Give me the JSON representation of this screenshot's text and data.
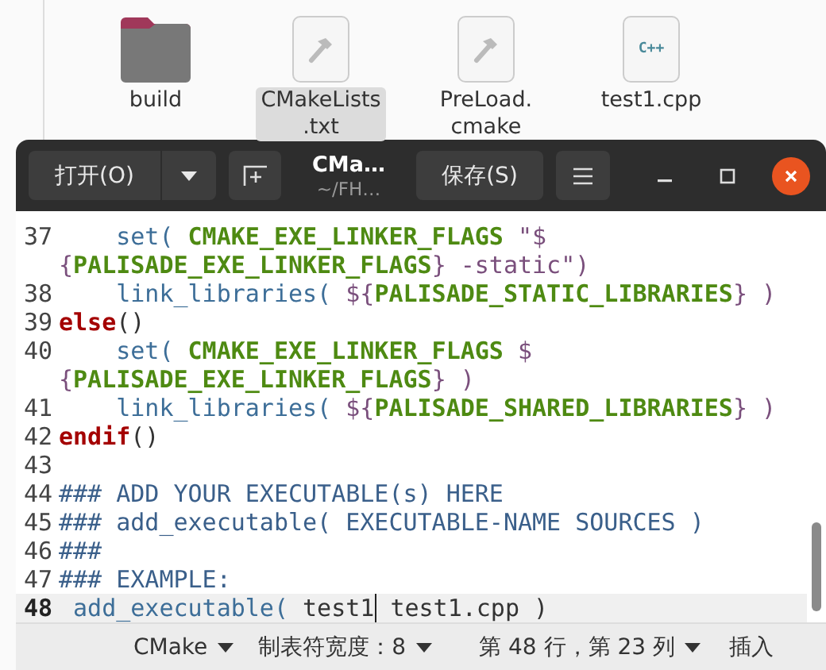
{
  "files": [
    {
      "name_lines": [
        "build"
      ],
      "kind": "folder",
      "selected": false
    },
    {
      "name_lines": [
        "CMakeLists",
        ".txt"
      ],
      "kind": "cmake",
      "selected": true
    },
    {
      "name_lines": [
        "PreLoad.",
        "cmake"
      ],
      "kind": "cmake",
      "selected": false
    },
    {
      "name_lines": [
        "test1.cpp"
      ],
      "kind": "source",
      "icon_text": "C++",
      "selected": false
    }
  ],
  "window": {
    "open_button": "打开(O)",
    "title": "CMa…",
    "subtitle": "~/FH…",
    "save_button": "保存(S)"
  },
  "code_lines": [
    {
      "number": "37",
      "current": false,
      "segments": [
        {
          "kind": "func",
          "text": "    set("
        },
        {
          "kind": "var",
          "text": " CMAKE_EXE_LINKER_FLAGS"
        },
        {
          "kind": "str",
          "text": " \"$"
        }
      ]
    },
    {
      "current": false,
      "segments": [
        {
          "kind": "str",
          "text": "{"
        },
        {
          "kind": "var",
          "text": "PALISADE_EXE_LINKER_FLAGS"
        },
        {
          "kind": "str",
          "text": "} -static\")"
        }
      ]
    },
    {
      "number": "38",
      "current": false,
      "segments": [
        {
          "kind": "func",
          "text": "    link_libraries("
        },
        {
          "kind": "str",
          "text": " ${"
        },
        {
          "kind": "var",
          "text": "PALISADE_STATIC_LIBRARIES"
        },
        {
          "kind": "str",
          "text": "} )"
        }
      ]
    },
    {
      "number": "39",
      "current": false,
      "segments": [
        {
          "kind": "kw",
          "text": "else"
        },
        {
          "kind": "plain",
          "text": "()"
        }
      ]
    },
    {
      "number": "40",
      "current": false,
      "segments": [
        {
          "kind": "func",
          "text": "    set("
        },
        {
          "kind": "var",
          "text": " CMAKE_EXE_LINKER_FLAGS"
        },
        {
          "kind": "str",
          "text": " $"
        }
      ]
    },
    {
      "current": false,
      "segments": [
        {
          "kind": "str",
          "text": "{"
        },
        {
          "kind": "var",
          "text": "PALISADE_EXE_LINKER_FLAGS"
        },
        {
          "kind": "str",
          "text": "} )"
        }
      ]
    },
    {
      "number": "41",
      "current": false,
      "segments": [
        {
          "kind": "func",
          "text": "    link_libraries("
        },
        {
          "kind": "str",
          "text": " ${"
        },
        {
          "kind": "var",
          "text": "PALISADE_SHARED_LIBRARIES"
        },
        {
          "kind": "str",
          "text": "} )"
        }
      ]
    },
    {
      "number": "42",
      "current": false,
      "segments": [
        {
          "kind": "kw",
          "text": "endif"
        },
        {
          "kind": "plain",
          "text": "()"
        }
      ]
    },
    {
      "number": "43",
      "current": false
    },
    {
      "number": "44",
      "current": false,
      "segments": [
        {
          "kind": "comment",
          "text": "### ADD YOUR EXECUTABLE(s) HERE"
        }
      ]
    },
    {
      "number": "45",
      "current": false,
      "segments": [
        {
          "kind": "comment",
          "text": "### add_executable( EXECUTABLE-NAME SOURCES )"
        }
      ]
    },
    {
      "number": "46",
      "current": false,
      "segments": [
        {
          "kind": "comment",
          "text": "###"
        }
      ]
    },
    {
      "number": "47",
      "current": false,
      "segments": [
        {
          "kind": "comment",
          "text": "### EXAMPLE:"
        }
      ]
    },
    {
      "number": "48",
      "current": true,
      "segments": [
        {
          "kind": "func",
          "text": " add_executable("
        },
        {
          "kind": "plain",
          "text": " test1"
        },
        {
          "kind": "cursor"
        },
        {
          "kind": "plain",
          "text": " test1.cpp )"
        }
      ]
    }
  ],
  "status_bar": {
    "language": "CMake",
    "tab_width": "制表符宽度：8",
    "position": "第 48 行，第 23 列",
    "mode": "插入"
  }
}
